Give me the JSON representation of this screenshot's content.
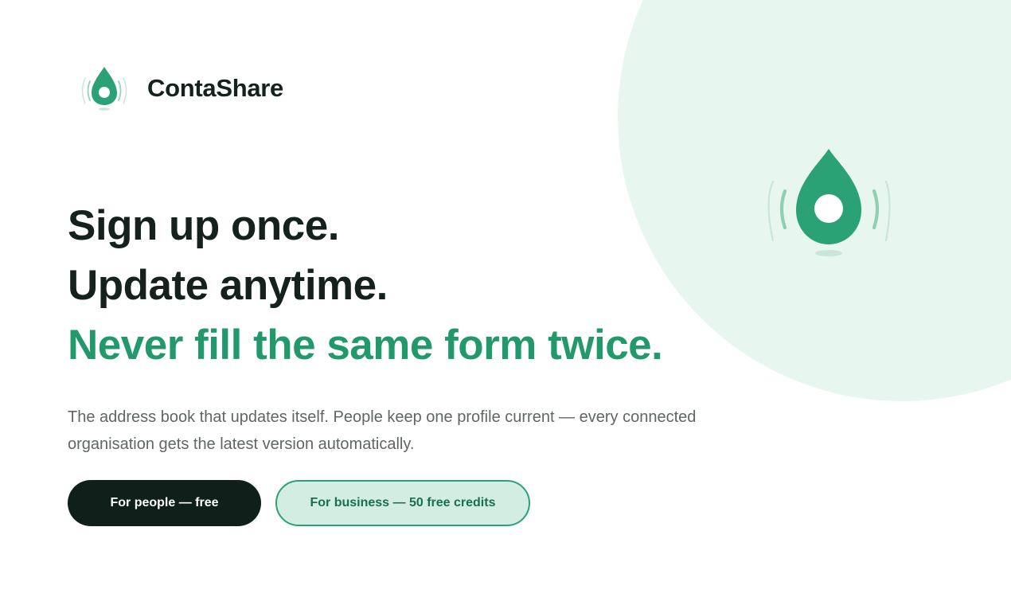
{
  "brand": {
    "name": "ContaShare",
    "icon": "droplet-signal-icon",
    "accent_color": "#22996b",
    "dark_color": "#14211c",
    "soft_bg_color": "#e8f6f0"
  },
  "hero": {
    "line1": "Sign up once.",
    "line2": "Update anytime.",
    "line3": "Never fill the same form twice.",
    "subtext": "The address book that updates itself. People keep one profile current — every connected organisation gets the latest version automatically."
  },
  "cta": {
    "people_label": "For people — free",
    "business_label": "For business — 50 free credits"
  }
}
